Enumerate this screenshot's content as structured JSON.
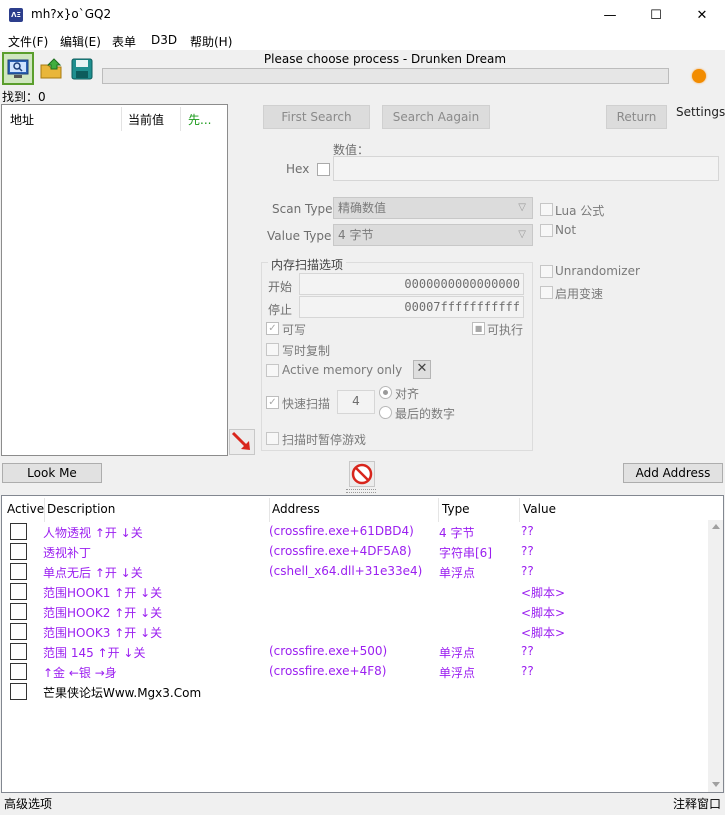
{
  "window": {
    "title": "mh?x}o`GQ2",
    "app_icon_text": "ΛΞ",
    "minimize": "—",
    "maximize": "☐",
    "close": "✕"
  },
  "menu": [
    "文件(F)",
    "编辑(E)",
    "表单",
    "D3D",
    "帮助(H)"
  ],
  "toolbar": {
    "process_title": "Please choose process - Drunken Dream",
    "found_label": "找到：",
    "found_count": "0"
  },
  "results_list": {
    "columns": [
      "地址",
      "当前值",
      "先..."
    ]
  },
  "scan": {
    "first_search": "First Search",
    "search_again": "Search Aagain",
    "return": "Return",
    "settings": "Settings",
    "value_label": "数值：",
    "hex_label": "Hex",
    "scan_type_label": "Scan Type",
    "scan_type_value": "精确数值",
    "value_type_label": "Value Type",
    "value_type_value": "4 字节",
    "lua_formula": "Lua 公式",
    "not_label": "Not",
    "unrandomizer": "Unrandomizer",
    "enable_speedhack": "启用变速",
    "mem_group_title": "内存扫描选项",
    "start_label": "开始",
    "start_value": "0000000000000000",
    "stop_label": "停止",
    "stop_value": "00007fffffffffff",
    "writable": "可写",
    "executable": "可执行",
    "copy_on_write": "写时复制",
    "active_memory_only": "Active memory only",
    "fast_scan": "快速扫描",
    "fast_scan_value": "4",
    "alignment": "对齐",
    "last_digits": "最后的数字",
    "pause_game": "扫描时暂停游戏"
  },
  "buttons": {
    "look_me": "Look Me",
    "add_address": "Add Address"
  },
  "address_table": {
    "columns": [
      "Active",
      "Description",
      "Address",
      "Type",
      "Value"
    ],
    "rows": [
      {
        "description": "人物透视  ↑开 ↓关",
        "address": "(crossfire.exe+61DBD4)",
        "type": "4 字节",
        "value": "??"
      },
      {
        "description": "透视补丁",
        "address": "(crossfire.exe+4DF5A8)",
        "type": "字符串[6]",
        "value": "??"
      },
      {
        "description": "单点无后   ↑开 ↓关",
        "address": "(cshell_x64.dll+31e33e4)",
        "type": "单浮点",
        "value": "??"
      },
      {
        "description": "范围HOOK1  ↑开 ↓关",
        "address": "",
        "type": "",
        "value": "<脚本>"
      },
      {
        "description": "范围HOOK2  ↑开 ↓关",
        "address": "",
        "type": "",
        "value": "<脚本>"
      },
      {
        "description": "范围HOOK3  ↑开 ↓关",
        "address": "",
        "type": "",
        "value": "<脚本>"
      },
      {
        "description": "范围 145   ↑开 ↓关",
        "address": "(crossfire.exe+500)",
        "type": "单浮点",
        "value": "??"
      },
      {
        "description": "↑金      ←银 →身",
        "address": "(crossfire.exe+4F8)",
        "type": "单浮点",
        "value": "??"
      },
      {
        "description": "芒果侠论坛Www.Mgx3.Com",
        "address": "",
        "type": "",
        "value": ""
      }
    ]
  },
  "statusbar": {
    "left": "高级选项",
    "right": "注释窗口"
  }
}
